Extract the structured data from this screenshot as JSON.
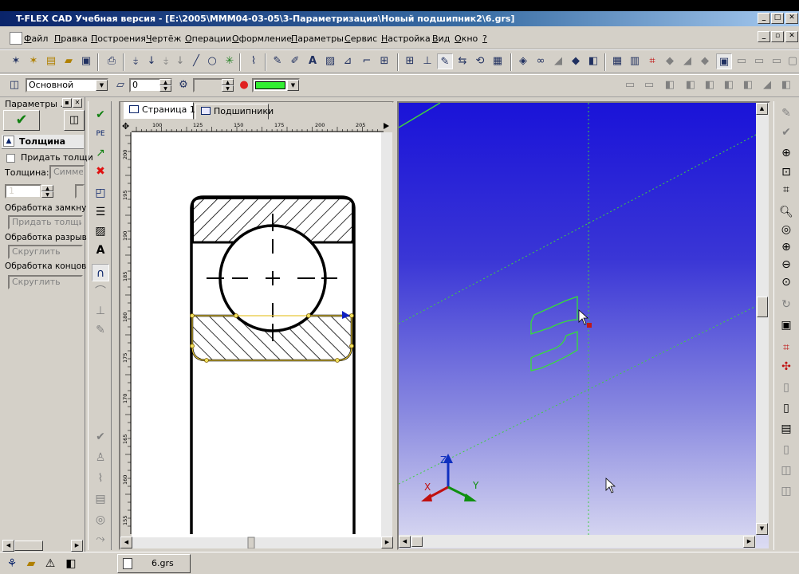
{
  "window": {
    "title": "T-FLEX CAD Учебная версия - [E:\\2005\\MMM04-03-05\\3-Параметризация\\Новый подшипник2\\6.grs]",
    "min_label": "_",
    "max_label": "□",
    "close_label": "✕"
  },
  "menu": {
    "items": [
      "Файл",
      "Правка",
      "Построения",
      "Чертёж",
      "Операции",
      "Оформление",
      "Параметры",
      "Сервис",
      "Настройка",
      "Вид",
      "Окно",
      "?"
    ],
    "underline": [
      "Ф",
      "П",
      "П",
      "Ч",
      "О",
      "О",
      "П",
      "С",
      "Н",
      "В",
      "О",
      "?"
    ]
  },
  "props_bar": {
    "layer_value": "Основной",
    "level_value": "0",
    "color_hex": "#33ee33"
  },
  "left_panel": {
    "header": "Параметры ...",
    "section_title": "Толщина",
    "checkbox_label": "Придать толщи",
    "thickness_label": "Толщина:",
    "thickness_placeholder": "Симмет",
    "spin_value": "1",
    "group1_label": "Обработка замкну",
    "group1_button": "Придать толщину",
    "group2_label": "Обработка разрыв",
    "group2_button": "Скруглить",
    "group3_label": "Обработка концов",
    "group3_button": "Скруглить"
  },
  "drawing": {
    "tabs": [
      "Страница 1",
      "Подшипники"
    ],
    "ruler_top": [
      "100",
      "125",
      "150",
      "175",
      "200",
      "205"
    ],
    "ruler_left": [
      "200",
      "195",
      "190",
      "185",
      "180",
      "175",
      "170",
      "165",
      "160",
      "155"
    ]
  },
  "view3d": {
    "axis_x": "X",
    "axis_y": "Y",
    "axis_z": "Z"
  },
  "statusbar": {
    "doc_tab": "6.grs"
  },
  "colors": {
    "title_bg": "#0a246a",
    "view_top": "#1a13d8",
    "view_bottom": "#dcdcf2",
    "wire_green": "#35e035"
  }
}
